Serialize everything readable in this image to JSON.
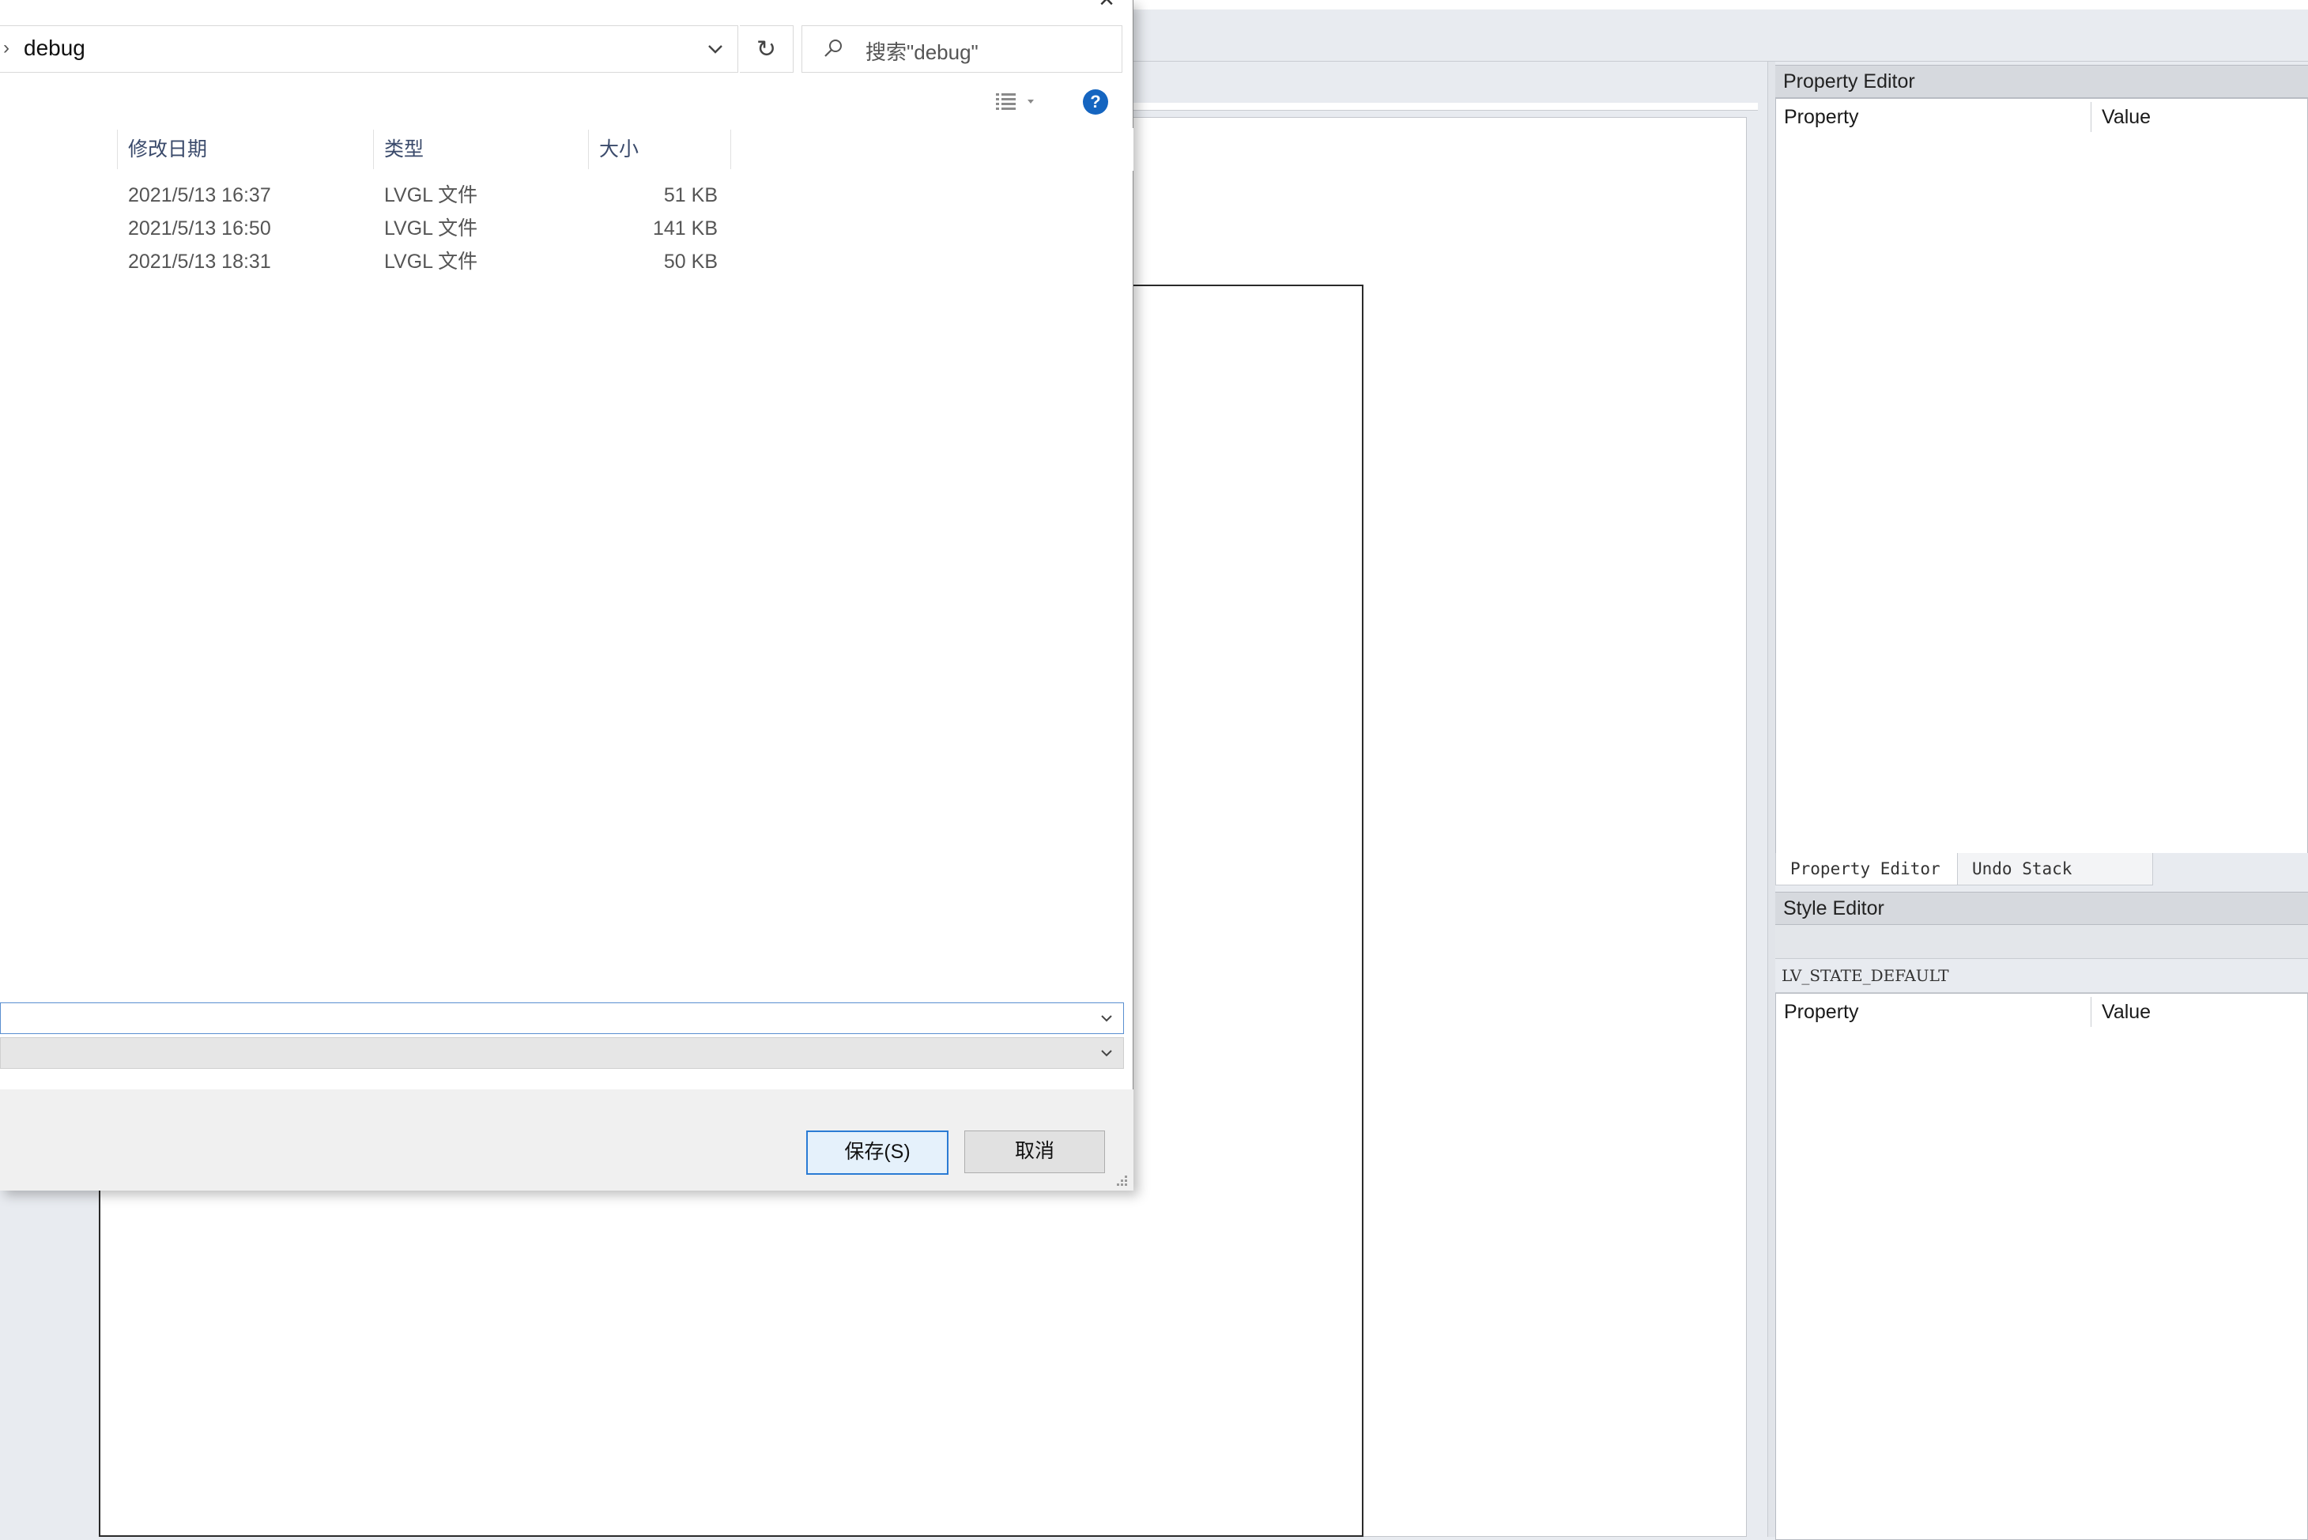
{
  "dialog": {
    "address_path": "debug",
    "search_placeholder": "搜索\"debug\"",
    "help_label": "?",
    "columns": {
      "modified": "修改日期",
      "type": "类型",
      "size": "大小"
    },
    "files": [
      {
        "modified": "2021/5/13 16:37",
        "type": "LVGL 文件",
        "size": "51 KB"
      },
      {
        "modified": "2021/5/13 16:50",
        "type": "LVGL 文件",
        "size": "141 KB"
      },
      {
        "modified": "2021/5/13 18:31",
        "type": "LVGL 文件",
        "size": "50 KB"
      }
    ],
    "filename_value": "",
    "filetype_value": "",
    "save_label": "保存(S)",
    "cancel_label": "取消"
  },
  "property_editor": {
    "title": "Property Editor",
    "col_property": "Property",
    "col_value": "Value"
  },
  "tabs": [
    {
      "label": "Property Editor"
    },
    {
      "label": "Undo Stack"
    }
  ],
  "style_editor": {
    "title": "Style Editor",
    "state": "LV_STATE_DEFAULT",
    "col_property": "Property",
    "col_value": "Value"
  },
  "colors": {
    "accent": "#1565c0",
    "focus_border": "#2a7bd4",
    "app_background": "#e8ebf0"
  }
}
